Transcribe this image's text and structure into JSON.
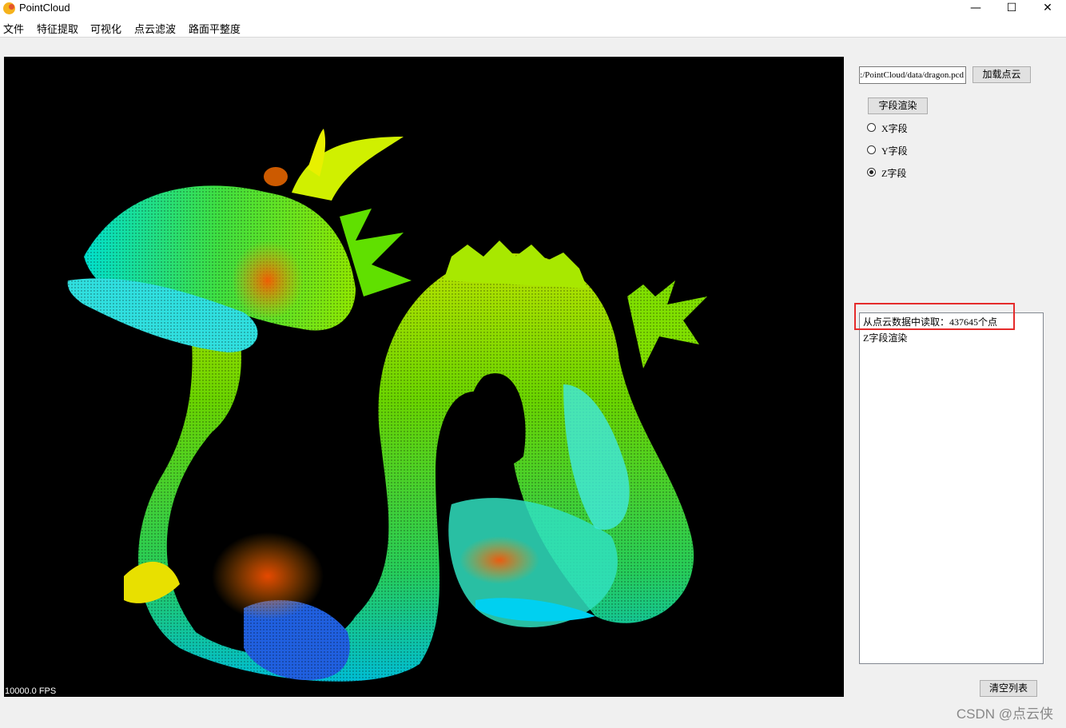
{
  "window": {
    "title": "PointCloud",
    "minimize": "—",
    "maximize": "☐",
    "close": "✕"
  },
  "menu": [
    "文件",
    "特征提取",
    "可视化",
    "点云滤波",
    "路面平整度"
  ],
  "viewport": {
    "fps_label": "10000.0 FPS",
    "background": "#000000"
  },
  "controls": {
    "path_value": "D:/PointCloud/data/dragon.pcd",
    "load_button": "加载点云",
    "field_render_button": "字段渲染",
    "radio_options": [
      "X字段",
      "Y字段",
      "Z字段"
    ],
    "radio_selected": "Z字段"
  },
  "log": {
    "lines": [
      "从点云数据中读取：437645个点",
      "Z字段渲染"
    ]
  },
  "clear_button": "清空列表",
  "watermark": "CSDN @点云侠",
  "colors": {
    "highlight_box": "#e52b2b",
    "gradient": [
      "#1030d0",
      "#00c8ff",
      "#00e870",
      "#c8f000",
      "#ffd000",
      "#ff6000"
    ]
  }
}
